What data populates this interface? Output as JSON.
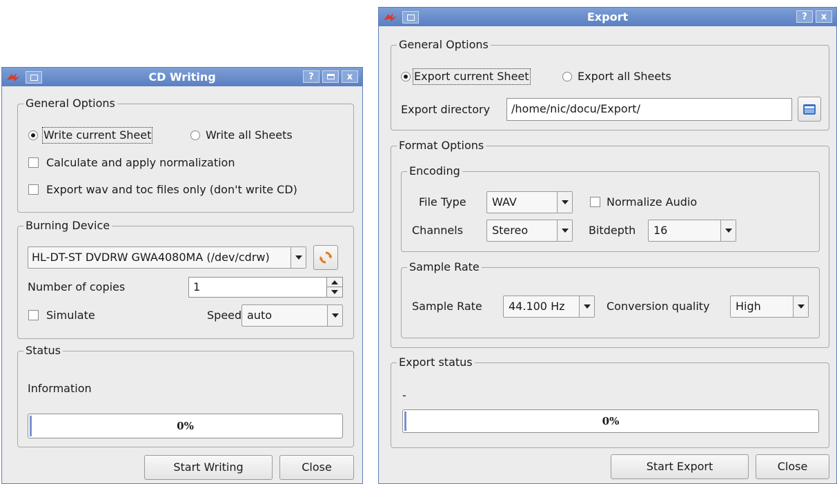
{
  "cd_writing": {
    "title": "CD Writing",
    "help_label": "?",
    "close_label": "x",
    "general": {
      "legend": "General Options",
      "write_current": "Write current Sheet",
      "write_all": "Write all Sheets",
      "normalize": "Calculate and apply normalization",
      "export_only": "Export wav and toc files only (don't write CD)"
    },
    "burning": {
      "legend": "Burning Device",
      "device": "HL-DT-ST DVDRW GWA4080MA (/dev/cdrw)",
      "copies_label": "Number of copies",
      "copies_value": "1",
      "simulate": "Simulate",
      "speed_label": "Speed",
      "speed_value": "auto"
    },
    "status": {
      "legend": "Status",
      "info": "Information",
      "progress_text": "0%",
      "progress": 0
    },
    "start_button": "Start Writing",
    "close_button": "Close"
  },
  "export": {
    "title": "Export",
    "help_label": "?",
    "close_label": "x",
    "general": {
      "legend": "General Options",
      "export_current": "Export current Sheet",
      "export_all": "Export all Sheets",
      "dir_label": "Export directory",
      "dir_value": "/home/nic/docu/Export/"
    },
    "format": {
      "legend": "Format Options",
      "encoding_legend": "Encoding",
      "file_type_label": "File Type",
      "file_type_value": "WAV",
      "normalize_audio": "Normalize Audio",
      "channels_label": "Channels",
      "channels_value": "Stereo",
      "bitdepth_label": "Bitdepth",
      "bitdepth_value": "16",
      "samplerate_legend": "Sample Rate",
      "samplerate_label": "Sample Rate",
      "samplerate_value": "44.100 Hz",
      "quality_label": "Conversion quality",
      "quality_value": "High"
    },
    "status": {
      "legend": "Export status",
      "info": "-",
      "progress_text": "0%",
      "progress": 0
    },
    "start_button": "Start Export",
    "close_button": "Close"
  },
  "colors": {
    "titlebar": "#5a7fc1",
    "window_bg": "#ececec",
    "progress_fill": "#7b8fd3"
  },
  "icons": [
    "app-logo-icon",
    "window-menu-icon",
    "help-icon",
    "maximize-icon",
    "close-icon",
    "refresh-icon",
    "folder-open-icon"
  ]
}
